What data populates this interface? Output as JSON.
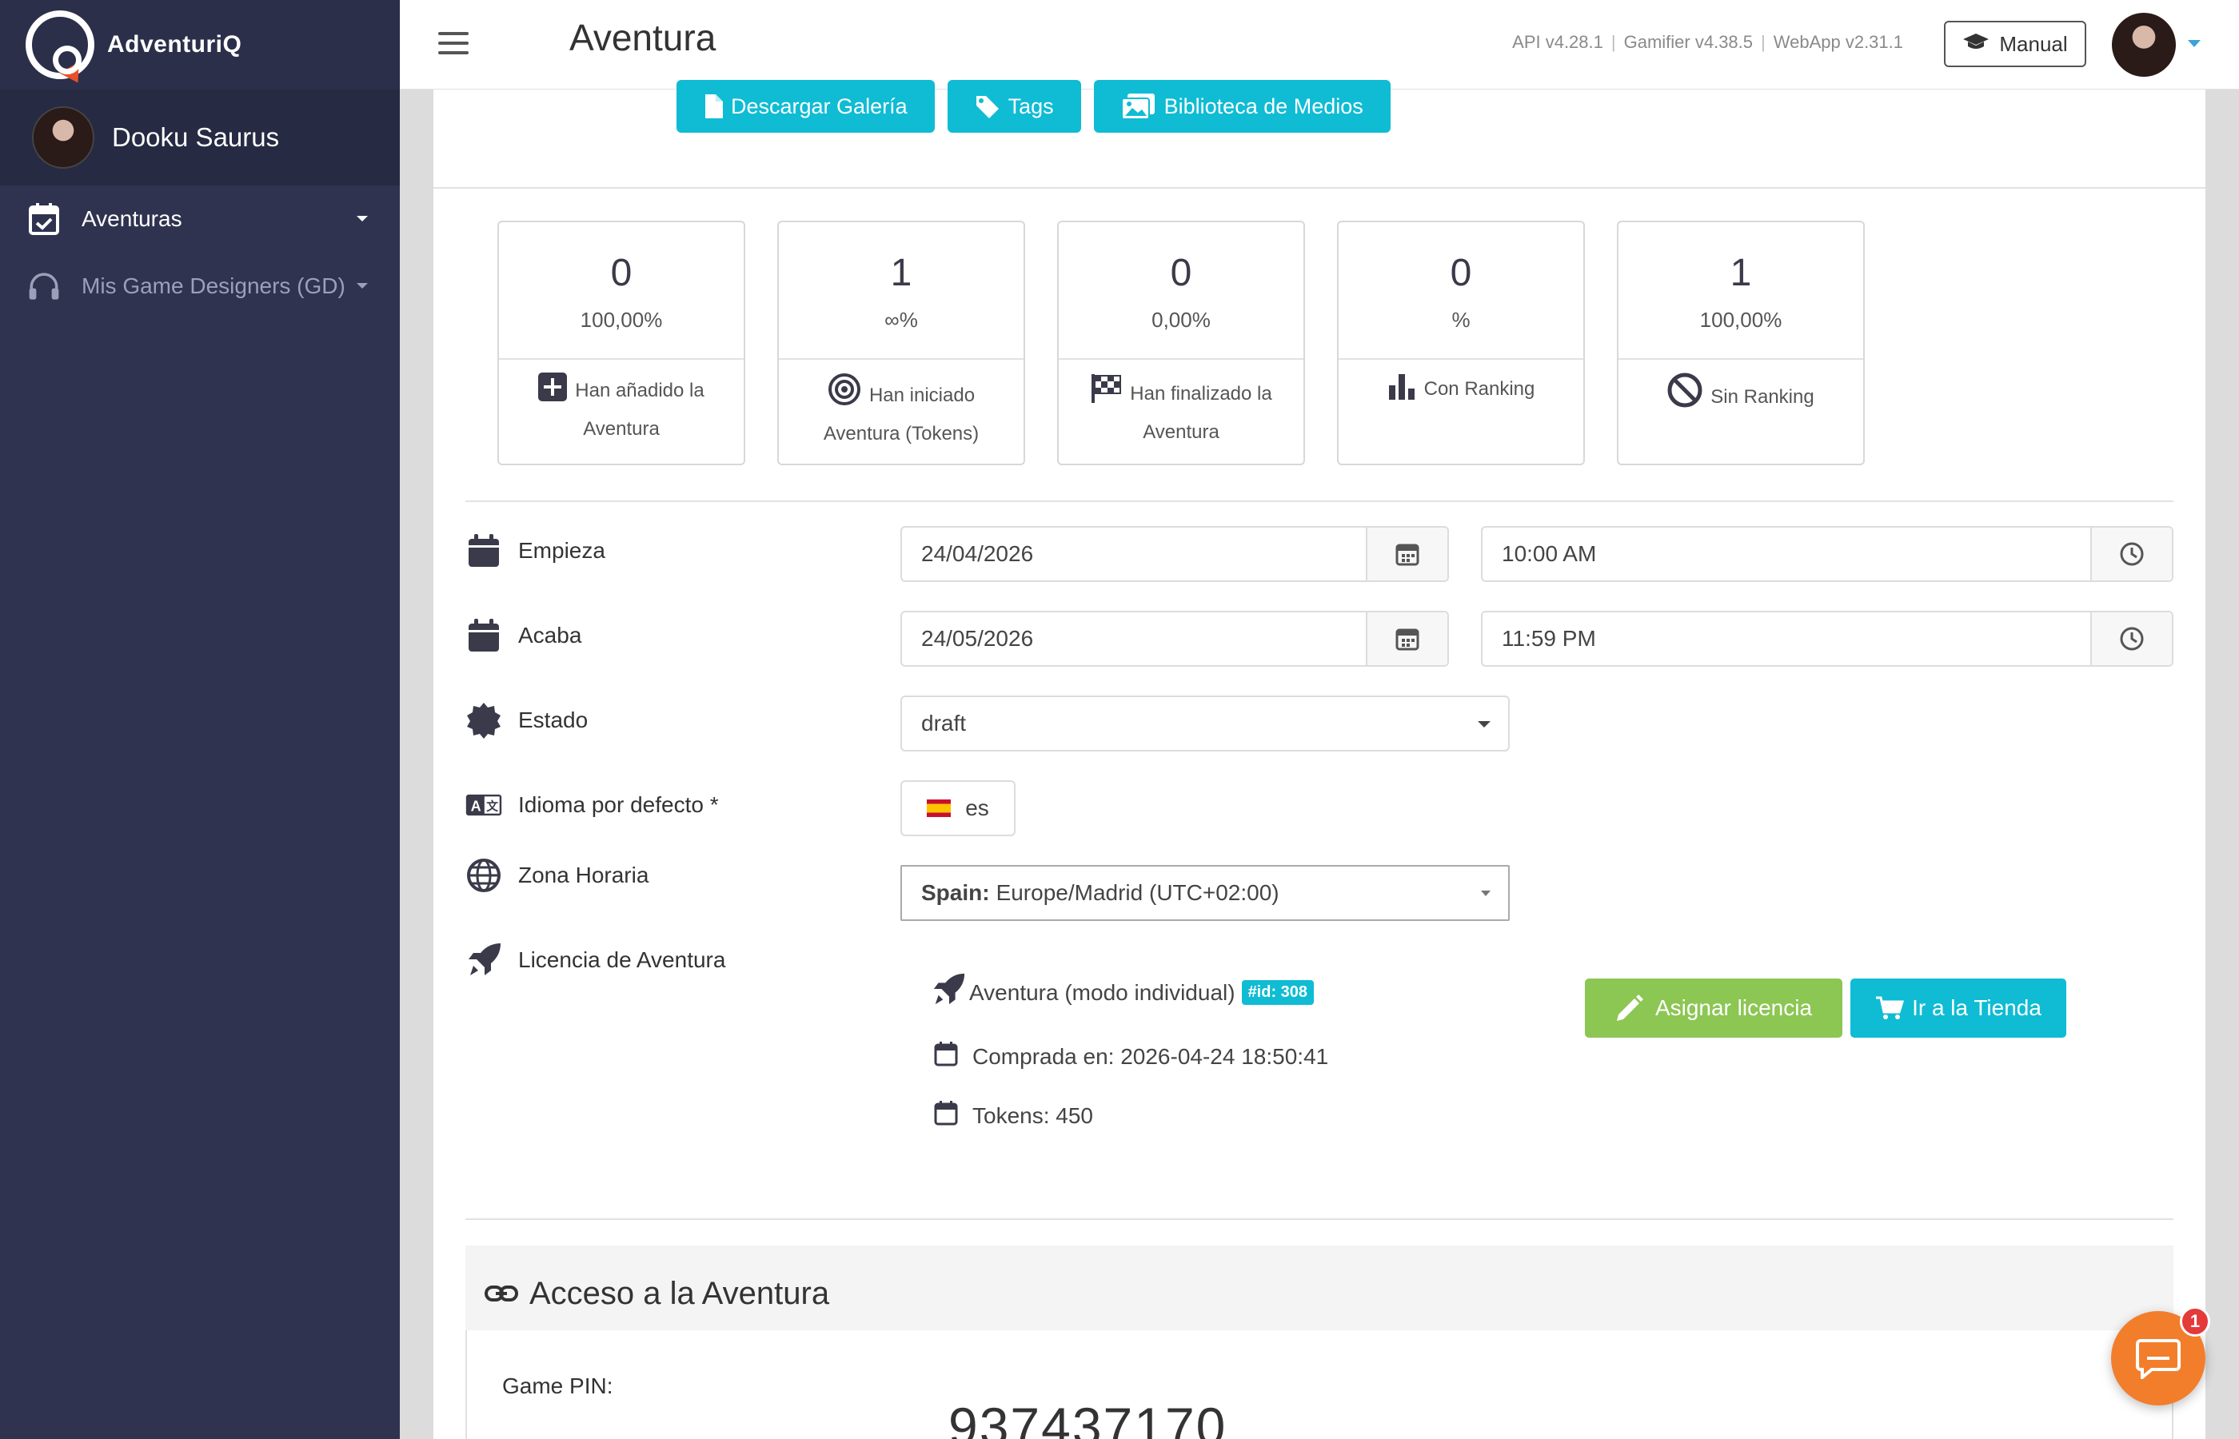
{
  "app": {
    "brand": "AdventuriQ"
  },
  "sidebar": {
    "user_name": "Dooku Saurus",
    "items": [
      {
        "label": "Aventuras",
        "icon": "calendar-check-icon"
      },
      {
        "label": "Mis Game Designers (GD)",
        "icon": "headphones-icon"
      }
    ]
  },
  "header": {
    "title": "Aventura",
    "versions": [
      "API v4.28.1",
      "Gamifier v4.38.5",
      "WebApp v2.31.1"
    ],
    "manual_label": "Manual"
  },
  "actions": {
    "download_gallery": "Descargar Galería",
    "tags": "Tags",
    "media_library": "Biblioteca de Medios"
  },
  "stats": [
    {
      "value": "0",
      "percent": "100,00%",
      "label": "Han añadido la Aventura",
      "icon": "plus-square-icon"
    },
    {
      "value": "1",
      "percent": "∞%",
      "label": "Han iniciado Aventura (Tokens)",
      "icon": "target-icon"
    },
    {
      "value": "0",
      "percent": "0,00%",
      "label": "Han finalizado la Aventura",
      "icon": "checkered-flag-icon"
    },
    {
      "value": "0",
      "percent": "%",
      "label": "Con Ranking",
      "icon": "bar-chart-icon"
    },
    {
      "value": "1",
      "percent": "100,00%",
      "label": "Sin Ranking",
      "icon": "ban-icon"
    }
  ],
  "form": {
    "start": {
      "label": "Empieza",
      "date": "24/04/2026",
      "time": "10:00 AM"
    },
    "end": {
      "label": "Acaba",
      "date": "24/05/2026",
      "time": "11:59 PM"
    },
    "status": {
      "label": "Estado",
      "value": "draft"
    },
    "language": {
      "label": "Idioma por defecto *",
      "value": "es"
    },
    "timezone": {
      "label": "Zona Horaria",
      "country": "Spain:",
      "value": "Europe/Madrid (UTC+02:00)"
    },
    "license": {
      "label": "Licencia de Aventura",
      "type": "Aventura (modo individual)",
      "id_badge": "#id: 308",
      "purchased": "Comprada en: 2026-04-24 18:50:41",
      "tokens": "Tokens: 450",
      "assign_label": "Asignar licencia",
      "shop_label": "Ir a la Tienda"
    }
  },
  "access": {
    "title": "Acceso a la Aventura",
    "pin_label": "Game PIN:",
    "pin_value": "937437170"
  },
  "chat": {
    "badge": "1"
  },
  "colors": {
    "sidebar": "#2f3350",
    "accent": "#0fbcd4",
    "green": "#8cc653",
    "chat": "#f27e2c"
  }
}
